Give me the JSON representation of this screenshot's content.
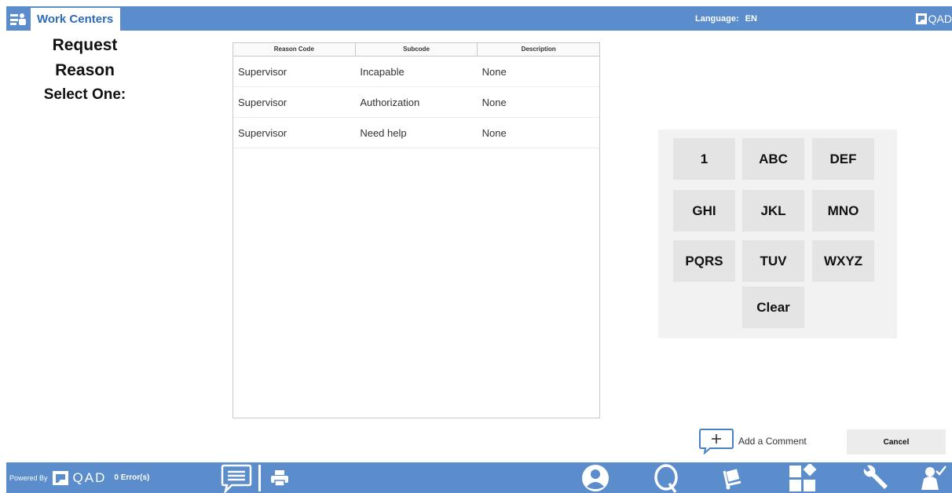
{
  "header": {
    "tab_label": "Work Centers",
    "language_label": "Language:",
    "language_value": "EN",
    "brand": "QAD"
  },
  "left": {
    "line1": "Request",
    "line2": "Reason",
    "line3": "Select One:"
  },
  "grid": {
    "columns": [
      "Reason Code",
      "Subcode",
      "Description"
    ],
    "rows": [
      [
        "Supervisor",
        "Incapable",
        "None"
      ],
      [
        "Supervisor",
        "Authorization",
        "None"
      ],
      [
        "Supervisor",
        "Need help",
        "None"
      ]
    ]
  },
  "keypad": {
    "keys": [
      "1",
      "ABC",
      "DEF",
      "GHI",
      "JKL",
      "MNO",
      "PQRS",
      "TUV",
      "WXYZ",
      "Clear"
    ]
  },
  "actions": {
    "add_comment": "Add a Comment",
    "cancel": "Cancel"
  },
  "footer": {
    "powered_by": "Powered By",
    "brand": "QAD",
    "errors": "0 Error(s)"
  },
  "colors": {
    "bar": "#5b8ccb",
    "tab_text": "#2e6bb8",
    "keypad_bg": "#f2f2f2",
    "key_bg": "#e4e4e4"
  }
}
